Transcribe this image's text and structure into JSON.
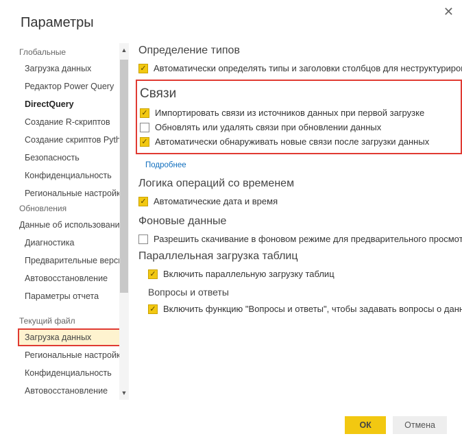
{
  "title": "Параметры",
  "sidebar": {
    "sections": [
      {
        "header": "Глобальные",
        "items": [
          "Загрузка данных",
          "Редактор Power Query",
          "DirectQuery",
          "Создание R-скриптов",
          "Создание скриптов Python",
          "Безопасность",
          "Конфиденциальность",
          "Региональные настройки",
          "Обновления",
          "Данные об использовании",
          "Диагностика",
          "Предварительные версии функций",
          "Автовосстановление",
          "Параметры отчета"
        ]
      },
      {
        "header": "Текущий файл",
        "items": [
          "Загрузка данных",
          "Региональные настройки",
          "Конфиденциальность",
          "Автовосстановление"
        ]
      }
    ],
    "active": "DirectQuery",
    "selected": "Загрузка данных"
  },
  "content": {
    "type_detection": {
      "title": "Определение типов",
      "opt1": "Автоматически определять типы и заголовки столбцов для неструктурированных"
    },
    "relations": {
      "title": "Связи",
      "opt1": "Импортировать связи из источников данных при первой загрузке",
      "opt2": "Обновлять или удалять связи при обновлении данных",
      "opt3": "Автоматически обнаруживать новые связи после загрузки данных",
      "more": "Подробнее"
    },
    "time_logic": {
      "title": "Логика операций со временем",
      "opt1": "Автоматические дата и время"
    },
    "background": {
      "title": "Фоновые данные",
      "opt1": "Разрешить скачивание в фоновом режиме для предварительного просмотра"
    },
    "parallel": {
      "title": "Параллельная загрузка таблиц",
      "opt1": "Включить параллельную загрузку таблиц"
    },
    "qna": {
      "title": "Вопросы и ответы",
      "opt1": "Включить функцию \"Вопросы и ответы\", чтобы задавать вопросы о данных"
    }
  },
  "footer": {
    "ok": "ОК",
    "cancel": "Отмена"
  }
}
